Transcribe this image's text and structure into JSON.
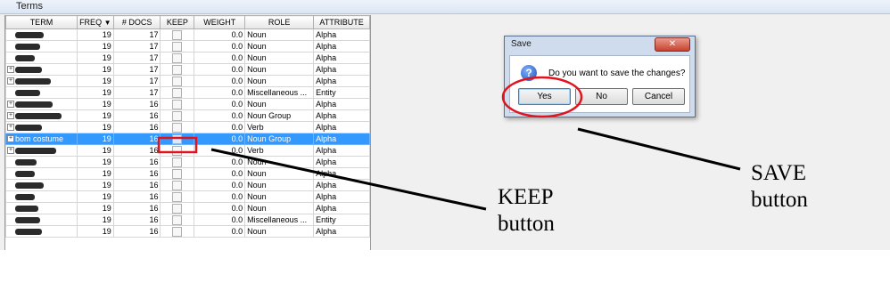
{
  "window": {
    "title": "Terms"
  },
  "grid": {
    "columns": [
      "TERM",
      "FREQ",
      "# DOCS",
      "KEEP",
      "WEIGHT",
      "ROLE",
      "ATTRIBUTE"
    ],
    "sort_indicator": "▼",
    "rows": [
      {
        "term": "",
        "freq": "19",
        "docs": "17",
        "weight": "0.0",
        "role": "Noun",
        "attribute": "Alpha",
        "expand": false
      },
      {
        "term": "",
        "freq": "19",
        "docs": "17",
        "weight": "0.0",
        "role": "Noun",
        "attribute": "Alpha",
        "expand": false
      },
      {
        "term": "",
        "freq": "19",
        "docs": "17",
        "weight": "0.0",
        "role": "Noun",
        "attribute": "Alpha",
        "expand": false
      },
      {
        "term": "",
        "freq": "19",
        "docs": "17",
        "weight": "0.0",
        "role": "Noun",
        "attribute": "Alpha",
        "expand": true
      },
      {
        "term": "",
        "freq": "19",
        "docs": "17",
        "weight": "0.0",
        "role": "Noun",
        "attribute": "Alpha",
        "expand": true
      },
      {
        "term": "",
        "freq": "19",
        "docs": "17",
        "weight": "0.0",
        "role": "Miscellaneous ...",
        "attribute": "Entity",
        "expand": false
      },
      {
        "term": "",
        "freq": "19",
        "docs": "16",
        "weight": "0.0",
        "role": "Noun",
        "attribute": "Alpha",
        "expand": true
      },
      {
        "term": "",
        "freq": "19",
        "docs": "16",
        "weight": "0.0",
        "role": "Noun Group",
        "attribute": "Alpha",
        "expand": true
      },
      {
        "term": "",
        "freq": "19",
        "docs": "16",
        "weight": "0.0",
        "role": "Verb",
        "attribute": "Alpha",
        "expand": true
      },
      {
        "term": "bom costume",
        "freq": "19",
        "docs": "16",
        "weight": "0.0",
        "role": "Noun Group",
        "attribute": "Alpha",
        "expand": true,
        "selected": true
      },
      {
        "term": "",
        "freq": "19",
        "docs": "16",
        "weight": "0.0",
        "role": "Verb",
        "attribute": "Alpha",
        "expand": true
      },
      {
        "term": "",
        "freq": "19",
        "docs": "16",
        "weight": "0.0",
        "role": "Noun",
        "attribute": "Alpha",
        "expand": false
      },
      {
        "term": "",
        "freq": "19",
        "docs": "16",
        "weight": "0.0",
        "role": "Noun",
        "attribute": "Alpha",
        "expand": false
      },
      {
        "term": "",
        "freq": "19",
        "docs": "16",
        "weight": "0.0",
        "role": "Noun",
        "attribute": "Alpha",
        "expand": false
      },
      {
        "term": "",
        "freq": "19",
        "docs": "16",
        "weight": "0.0",
        "role": "Noun",
        "attribute": "Alpha",
        "expand": false
      },
      {
        "term": "",
        "freq": "19",
        "docs": "16",
        "weight": "0.0",
        "role": "Noun",
        "attribute": "Alpha",
        "expand": false
      },
      {
        "term": "",
        "freq": "19",
        "docs": "16",
        "weight": "0.0",
        "role": "Miscellaneous ...",
        "attribute": "Entity",
        "expand": false
      },
      {
        "term": "",
        "freq": "19",
        "docs": "16",
        "weight": "0.0",
        "role": "Noun",
        "attribute": "Alpha",
        "expand": false
      }
    ]
  },
  "dialog": {
    "title": "Save",
    "close_glyph": "✕",
    "message": "Do you want to save the changes?",
    "icon": "question-icon",
    "icon_glyph": "?",
    "buttons": {
      "yes": "Yes",
      "no": "No",
      "cancel": "Cancel"
    }
  },
  "annotations": {
    "keep_line1": "KEEP",
    "keep_line2": "button",
    "save_line1": "SAVE",
    "save_line2": "button",
    "highlight_color": "#e0141e"
  },
  "colors": {
    "selection": "#3399ff",
    "dialog_frame": "#cfdced"
  }
}
